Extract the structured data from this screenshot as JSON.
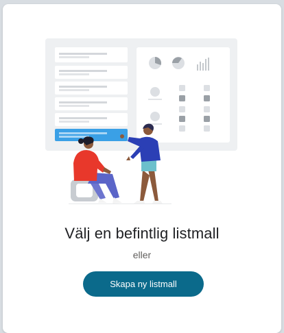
{
  "dialog": {
    "heading": "Välj en befintlig listmall",
    "separator": "eller",
    "create_button_label": "Skapa ny listmall"
  },
  "colors": {
    "button_bg": "#0b6a8b",
    "highlight_row": "#3aa0e6",
    "person_left_top": "#e8382b",
    "person_right_top": "#2b3fb5"
  },
  "illustration": {
    "icons": [
      "pie-chart-icon",
      "pie-chart-icon",
      "bar-chart-icon",
      "user-icon",
      "user-icon"
    ]
  }
}
